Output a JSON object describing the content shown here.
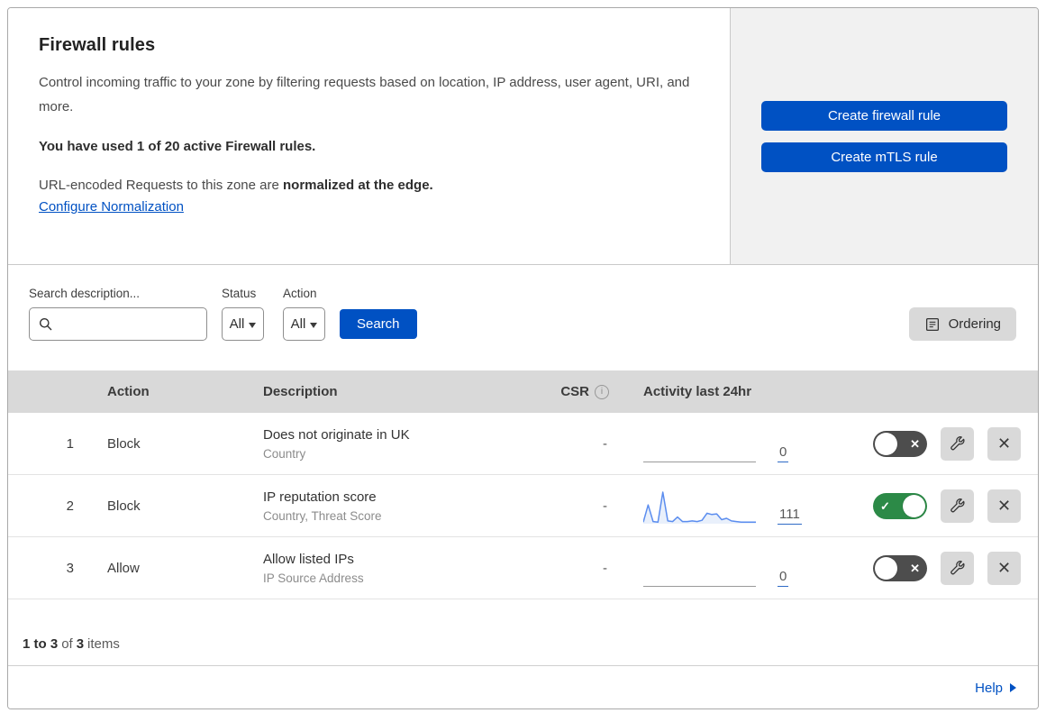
{
  "header": {
    "title": "Firewall rules",
    "description": "Control incoming traffic to your zone by filtering requests based on location, IP address, user agent, URI, and more.",
    "usage_bold": "You have used 1 of 20 active Firewall rules.",
    "normalization_prefix": "URL-encoded Requests to this zone are ",
    "normalization_bold": "normalized at the edge.",
    "normalization_link": "Configure Normalization"
  },
  "actions_panel": {
    "create_firewall_rule": "Create firewall rule",
    "create_mtls_rule": "Create mTLS rule"
  },
  "filters": {
    "search_label": "Search description...",
    "search_placeholder": "",
    "status_label": "Status",
    "status_value": "All",
    "action_label": "Action",
    "action_value": "All",
    "search_button": "Search",
    "ordering_button": "Ordering"
  },
  "table": {
    "headers": {
      "action": "Action",
      "description": "Description",
      "csr": "CSR",
      "activity": "Activity last 24hr"
    },
    "rows": [
      {
        "num": "1",
        "action": "Block",
        "title": "Does not originate in UK",
        "subtitle": "Country",
        "csr": "-",
        "activity_count": "0",
        "enabled": false
      },
      {
        "num": "2",
        "action": "Block",
        "title": "IP reputation score",
        "subtitle": "Country, Threat Score",
        "csr": "-",
        "activity_count": "111",
        "enabled": true,
        "sparkline": [
          1,
          28,
          2,
          1,
          48,
          3,
          2,
          9,
          2,
          2,
          3,
          2,
          4,
          15,
          13,
          14,
          5,
          7,
          3,
          2,
          1,
          1,
          1,
          1
        ]
      },
      {
        "num": "3",
        "action": "Allow",
        "title": "Allow listed IPs",
        "subtitle": "IP Source Address",
        "csr": "-",
        "activity_count": "0",
        "enabled": false
      }
    ]
  },
  "pagination": {
    "range": "1 to 3",
    "of_label": "of",
    "total": "3",
    "items_label": "items"
  },
  "footer": {
    "help_label": "Help"
  },
  "icons": {
    "search": "magnifying-glass",
    "caret": "triangle-down",
    "ordering": "list-lines",
    "info_glyph": "i",
    "toggle_on_glyph": "✓",
    "toggle_off_glyph": "✕",
    "wrench": "wrench",
    "delete_glyph": "✕",
    "help_arrow": "triangle-right"
  },
  "colors": {
    "accent_blue": "#0051c3",
    "toggle_on_green": "#2c8a47",
    "toggle_off_gray": "#4d4d4d",
    "sparkline_blue": "#5b8def",
    "panel_gray": "#f1f1f1",
    "table_header_gray": "#d9d9d9",
    "button_gray": "#d9d9d9"
  }
}
